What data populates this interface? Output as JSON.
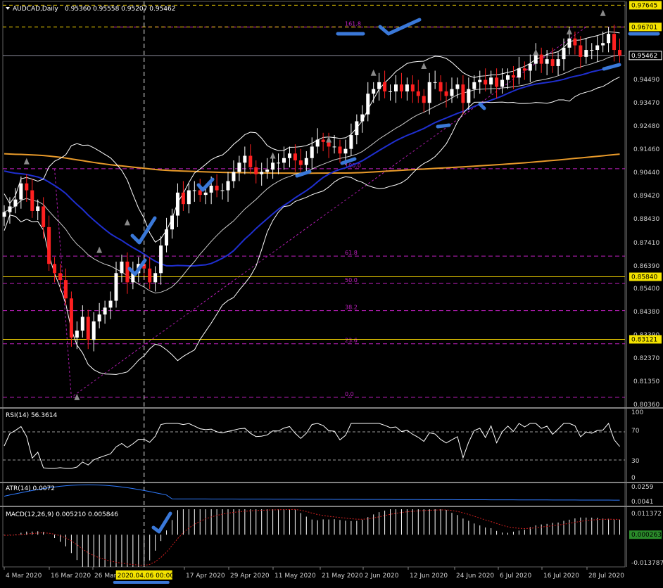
{
  "header": {
    "symbol": "AUDCAD,Daily",
    "ohlc": "0.95360 0.95558 0.95207 0.95462"
  },
  "colors": {
    "background": "#000000",
    "bull_candle": "#ffffff",
    "bear_candle": "#ff2020",
    "fib_lines": "#c01fc0",
    "ma_fast": "#1f2fd0",
    "ma_slow": "#e89a2a",
    "bollinger": "#ffffff",
    "highlight_level": "#f0d000",
    "annotation": "#3a78d8",
    "histogram": "#ffffff",
    "signal": "#d02020"
  },
  "price_axis": {
    "ticks": [
      "0.97645",
      "0.96701",
      "0.95462",
      "0.94490",
      "0.93470",
      "0.92480",
      "0.91460",
      "0.90440",
      "0.89420",
      "0.88430",
      "0.87410",
      "0.86390",
      "0.85400",
      "0.84380",
      "0.83390",
      "0.82370",
      "0.81350",
      "0.80360"
    ],
    "highlighted": [
      {
        "label": "0.97645",
        "value": 0.97645,
        "style": "yellow"
      },
      {
        "label": "0.96701",
        "value": 0.96701,
        "style": "yellow"
      },
      {
        "label": "0.95462",
        "value": 0.95462,
        "style": "current"
      },
      {
        "label": "0.85840",
        "value": 0.8584,
        "style": "yellow"
      },
      {
        "label": "0.83121",
        "value": 0.83121,
        "style": "yellow"
      }
    ]
  },
  "date_axis": {
    "ticks": [
      "4 Mar 2020",
      "16 Mar 2020",
      "26 Mar 2020",
      "17 Apr 2020",
      "29 Apr 2020",
      "11 May 2020",
      "21 May 2020",
      "2 Jun 2020",
      "12 Jun 2020",
      "24 Jun 2020",
      "6 Jul 2020",
      "16 Jul 2020",
      "28 Jul 2020"
    ],
    "crosshair_label": "2020.04.06 00:00"
  },
  "fibonacci": [
    {
      "label": "161.8",
      "value": 0.967
    },
    {
      "label": "100.0",
      "value": 0.9054
    },
    {
      "label": "61.8",
      "value": 0.8674
    },
    {
      "label": "50.0",
      "value": 0.8555
    },
    {
      "label": "38.2",
      "value": 0.8437
    },
    {
      "label": "23.6",
      "value": 0.8293
    },
    {
      "label": "0.0",
      "value": 0.806
    }
  ],
  "rsi": {
    "label": "RSI(14) 56.3614",
    "levels": [
      "100",
      "70",
      "30",
      "0"
    ]
  },
  "atr": {
    "label": "ATR(14) 0.0072",
    "levels": [
      "0.0259",
      "0.0041"
    ]
  },
  "macd": {
    "label": "MACD(12,26,9) 0.005210 0.005846",
    "levels": [
      "0.011372",
      "0.000263",
      "-0.013787"
    ]
  },
  "chart_data": {
    "type": "candlestick",
    "title": "AUDCAD,Daily",
    "ylim": [
      0.802,
      0.9775
    ],
    "current_price": 0.95462,
    "x": [
      "2020-03-02",
      "2020-03-03",
      "2020-03-04",
      "2020-03-05",
      "2020-03-06",
      "2020-03-09",
      "2020-03-10",
      "2020-03-11",
      "2020-03-12",
      "2020-03-13",
      "2020-03-16",
      "2020-03-17",
      "2020-03-18",
      "2020-03-19",
      "2020-03-20",
      "2020-03-23",
      "2020-03-24",
      "2020-03-25",
      "2020-03-26",
      "2020-03-27",
      "2020-03-30",
      "2020-03-31",
      "2020-04-01",
      "2020-04-02",
      "2020-04-03",
      "2020-04-06",
      "2020-04-07",
      "2020-04-08",
      "2020-04-09",
      "2020-04-10",
      "2020-04-13",
      "2020-04-14",
      "2020-04-15",
      "2020-04-16",
      "2020-04-17",
      "2020-04-20",
      "2020-04-21",
      "2020-04-22",
      "2020-04-23",
      "2020-04-24",
      "2020-04-27",
      "2020-04-28",
      "2020-04-29",
      "2020-04-30",
      "2020-05-01",
      "2020-05-04",
      "2020-05-05",
      "2020-05-06",
      "2020-05-07",
      "2020-05-08",
      "2020-05-11",
      "2020-05-12",
      "2020-05-13",
      "2020-05-14",
      "2020-05-15",
      "2020-05-18",
      "2020-05-19",
      "2020-05-20",
      "2020-05-21",
      "2020-05-22",
      "2020-05-25",
      "2020-05-26",
      "2020-05-27",
      "2020-05-28",
      "2020-05-29",
      "2020-06-01",
      "2020-06-02",
      "2020-06-03",
      "2020-06-04",
      "2020-06-05",
      "2020-06-08",
      "2020-06-09",
      "2020-06-10",
      "2020-06-11",
      "2020-06-12",
      "2020-06-15",
      "2020-06-16",
      "2020-06-17",
      "2020-06-18",
      "2020-06-19",
      "2020-06-22",
      "2020-06-23",
      "2020-06-24",
      "2020-06-25",
      "2020-06-26",
      "2020-06-29",
      "2020-06-30",
      "2020-07-01",
      "2020-07-02",
      "2020-07-03",
      "2020-07-06",
      "2020-07-07",
      "2020-07-08",
      "2020-07-09",
      "2020-07-10",
      "2020-07-13",
      "2020-07-14",
      "2020-07-15",
      "2020-07-16",
      "2020-07-17",
      "2020-07-20",
      "2020-07-21",
      "2020-07-22",
      "2020-07-23",
      "2020-07-24",
      "2020-07-27",
      "2020-07-28",
      "2020-07-29",
      "2020-07-30",
      "2020-07-31",
      "2020-08-03"
    ],
    "close": [
      0.8865,
      0.889,
      0.892,
      0.899,
      0.896,
      0.887,
      0.889,
      0.88,
      0.864,
      0.86,
      0.857,
      0.849,
      0.832,
      0.835,
      0.841,
      0.831,
      0.839,
      0.842,
      0.845,
      0.848,
      0.86,
      0.865,
      0.856,
      0.86,
      0.864,
      0.862,
      0.856,
      0.86,
      0.872,
      0.879,
      0.885,
      0.895,
      0.89,
      0.896,
      0.896,
      0.894,
      0.895,
      0.898,
      0.896,
      0.896,
      0.9,
      0.904,
      0.908,
      0.911,
      0.906,
      0.903,
      0.904,
      0.905,
      0.908,
      0.908,
      0.91,
      0.912,
      0.909,
      0.907,
      0.91,
      0.915,
      0.918,
      0.917,
      0.915,
      0.915,
      0.912,
      0.914,
      0.92,
      0.926,
      0.929,
      0.938,
      0.94,
      0.943,
      0.939,
      0.939,
      0.942,
      0.939,
      0.942,
      0.939,
      0.937,
      0.934,
      0.943,
      0.943,
      0.939,
      0.937,
      0.94,
      0.942,
      0.934,
      0.94,
      0.943,
      0.944,
      0.942,
      0.945,
      0.941,
      0.944,
      0.946,
      0.945,
      0.949,
      0.948,
      0.951,
      0.955,
      0.951,
      0.953,
      0.95,
      0.953,
      0.958,
      0.962,
      0.959,
      0.954,
      0.957,
      0.957,
      0.959,
      0.96,
      0.964,
      0.957,
      0.9546
    ],
    "rsi_levels": [
      70,
      30
    ],
    "atr_range": [
      0.0041,
      0.0259
    ],
    "macd_range": [
      -0.013787,
      0.011372
    ],
    "macd_latest": 0.00521,
    "macd_signal_latest": 0.005846
  }
}
